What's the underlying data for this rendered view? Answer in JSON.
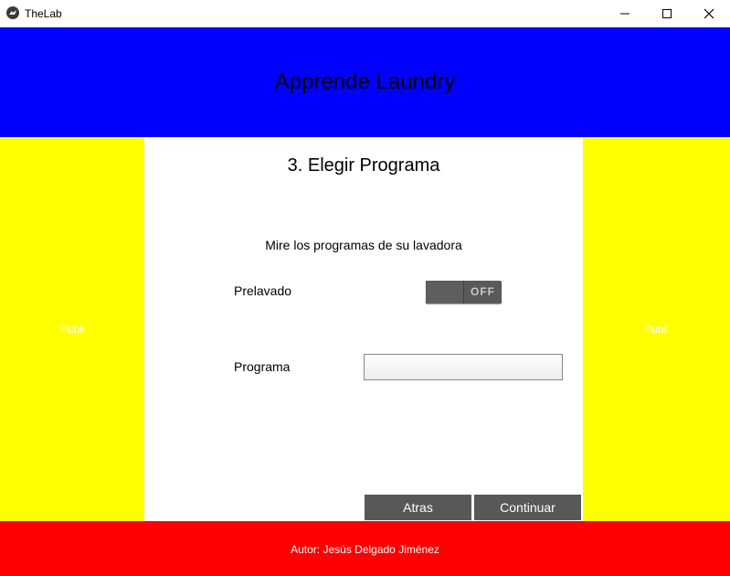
{
  "window": {
    "title": "TheLab",
    "icons": {
      "app": "kivy-logo-icon",
      "minimize": "minimize-icon",
      "maximize": "maximize-icon",
      "close": "close-icon"
    }
  },
  "header": {
    "title": "Apprende Laundry",
    "background": "#0000ff"
  },
  "ads": {
    "left_label": "Publi",
    "right_label": "Publi",
    "background": "#ffff00"
  },
  "main": {
    "step_title": "3. Elegir Programa",
    "instructions": "Mire los programas de su lavadora",
    "prelavado": {
      "label": "Prelavado",
      "toggle_state": "OFF"
    },
    "programa": {
      "label": "Programa",
      "value": ""
    },
    "buttons": {
      "back": "Atras",
      "next": "Continuar"
    }
  },
  "footer": {
    "author": "Autor: Jesús Delgado Jiménez",
    "background": "#ff0000"
  }
}
